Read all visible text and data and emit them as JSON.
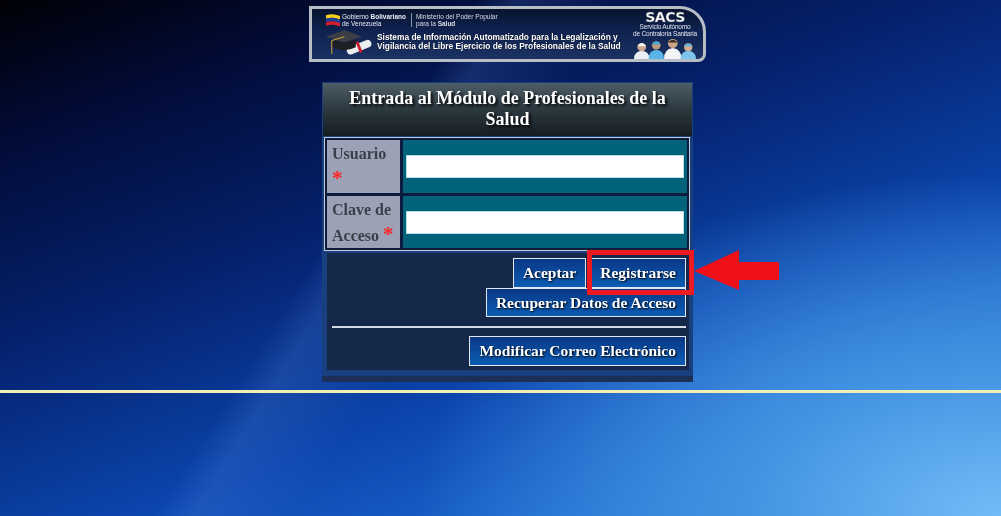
{
  "banner": {
    "government": {
      "lines": [
        "Gobierno **Bolivariano**",
        "de Venezuela"
      ]
    },
    "ministry": {
      "lines": [
        "Ministerio del Poder Popular",
        "para la **Salud**"
      ]
    },
    "agency": {
      "logo": "SACS",
      "lines": [
        "Servicio Autónomo",
        "de Contraloría Sanitaria"
      ]
    },
    "title_lines": [
      "Sistema de Información Automatizado para la Legalización y",
      "Vigilancia del Libre Ejercicio de los Profesionales de la Salud"
    ]
  },
  "login": {
    "title": "Entrada al Módulo de Profesionales de la Salud",
    "fields": [
      {
        "label": "Usuario",
        "required_mark": "*"
      },
      {
        "label": "Clave de Acceso",
        "required_mark": "*"
      }
    ],
    "button_rows": [
      [
        {
          "label": "Aceptar",
          "highlighted": false
        },
        {
          "label": "Registrarse",
          "highlighted": true
        }
      ],
      [
        {
          "label": "Recuperar Datos de Acceso",
          "highlighted": false
        }
      ]
    ],
    "secondary_buttons": [
      {
        "label": "Modificar Correo Electrónico",
        "highlighted": false
      }
    ]
  }
}
